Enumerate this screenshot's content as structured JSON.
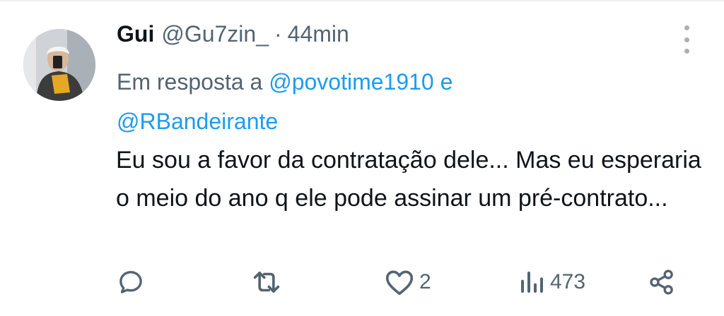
{
  "tweet": {
    "author_name": "Gui",
    "handle": "@Gu7zin_",
    "separator": "·",
    "time": "44min",
    "reply_prefix": "Em resposta a",
    "reply_users": [
      "@povotime1910",
      "@RBandeirante"
    ],
    "reply_conjunction": "e",
    "text": "Eu sou a favor da contratação dele... Mas eu esperaria o meio do ano q ele pode assinar um pré-contrato..."
  },
  "actions": {
    "reply": {
      "icon": "reply-icon",
      "count": ""
    },
    "retweet": {
      "icon": "retweet-icon",
      "count": ""
    },
    "like": {
      "icon": "heart-icon",
      "count": "2"
    },
    "views": {
      "icon": "views-icon",
      "count": "473"
    },
    "share": {
      "icon": "share-icon"
    }
  },
  "colors": {
    "accent": "#1d9bf0",
    "secondary_text": "#536471",
    "primary_text": "#0f1419"
  }
}
